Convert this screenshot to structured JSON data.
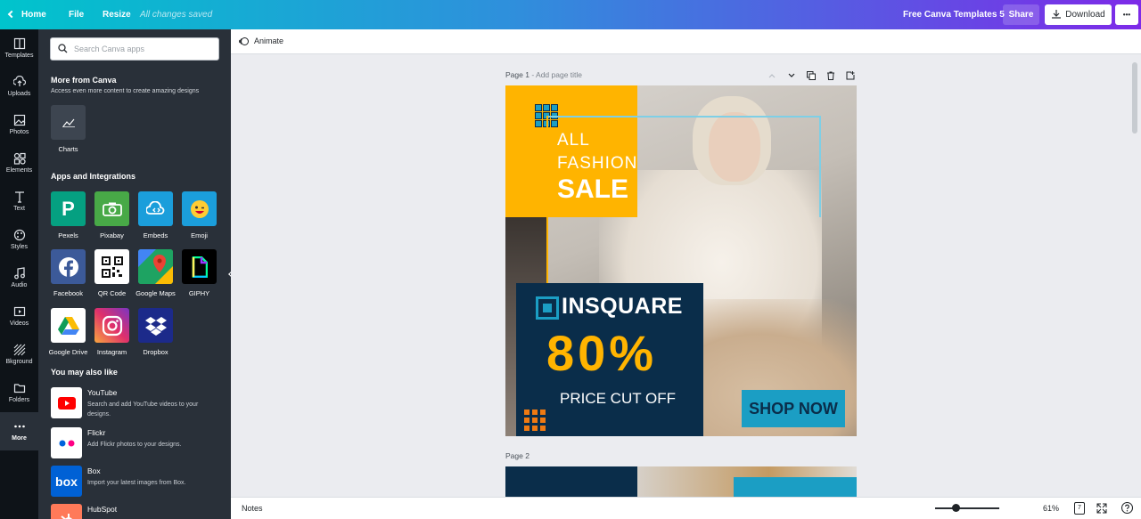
{
  "topbar": {
    "home": "Home",
    "file": "File",
    "resize": "Resize",
    "saved_status": "All changes saved",
    "design_title": "Free Canva Templates 5",
    "share": "Share",
    "download": "Download",
    "more": "•••"
  },
  "rail": [
    {
      "label": "Templates",
      "icon": "templates-icon"
    },
    {
      "label": "Uploads",
      "icon": "uploads-icon"
    },
    {
      "label": "Photos",
      "icon": "photos-icon"
    },
    {
      "label": "Elements",
      "icon": "elements-icon"
    },
    {
      "label": "Text",
      "icon": "text-icon"
    },
    {
      "label": "Styles",
      "icon": "styles-icon"
    },
    {
      "label": "Audio",
      "icon": "audio-icon"
    },
    {
      "label": "Videos",
      "icon": "videos-icon"
    },
    {
      "label": "Bkground",
      "icon": "background-icon"
    },
    {
      "label": "Folders",
      "icon": "folders-icon"
    },
    {
      "label": "More",
      "icon": "more-icon"
    }
  ],
  "panel": {
    "search_placeholder": "Search Canva apps",
    "more_title": "More from Canva",
    "more_sub": "Access even more content to create amazing designs",
    "charts": "Charts",
    "apps_title": "Apps and Integrations",
    "apps": [
      "Pexels",
      "Pixabay",
      "Embeds",
      "Emoji",
      "Facebook",
      "QR Code",
      "Google Maps",
      "GIPHY",
      "Google Drive",
      "Instagram",
      "Dropbox"
    ],
    "like_title": "You may also like",
    "likes": [
      {
        "name": "YouTube",
        "desc": "Search and add YouTube videos to your designs."
      },
      {
        "name": "Flickr",
        "desc": "Add Flickr photos to your designs."
      },
      {
        "name": "Box",
        "desc": "Import your latest images from Box."
      },
      {
        "name": "HubSpot",
        "desc": ""
      }
    ]
  },
  "subbar": {
    "animate": "Animate"
  },
  "canvas": {
    "page1_label": "Page 1",
    "page1_add": " - Add page title",
    "page2_label": "Page 2"
  },
  "design": {
    "line1": "ALL",
    "line2": "FASHION",
    "line3": "SALE",
    "brand": "INSQUARE",
    "discount": "80%",
    "subtitle": "PRICE CUT OFF",
    "cta": "SHOP NOW"
  },
  "bottombar": {
    "notes": "Notes",
    "zoom": "61%",
    "page_count": "7",
    "zoom_level": 0.32
  },
  "colors": {
    "yellow": "#ffb400",
    "navy": "#0a2d4a",
    "teal": "#1b9ec4",
    "orange": "#f07a12",
    "rail": "#0e1318",
    "panel": "#293039"
  }
}
